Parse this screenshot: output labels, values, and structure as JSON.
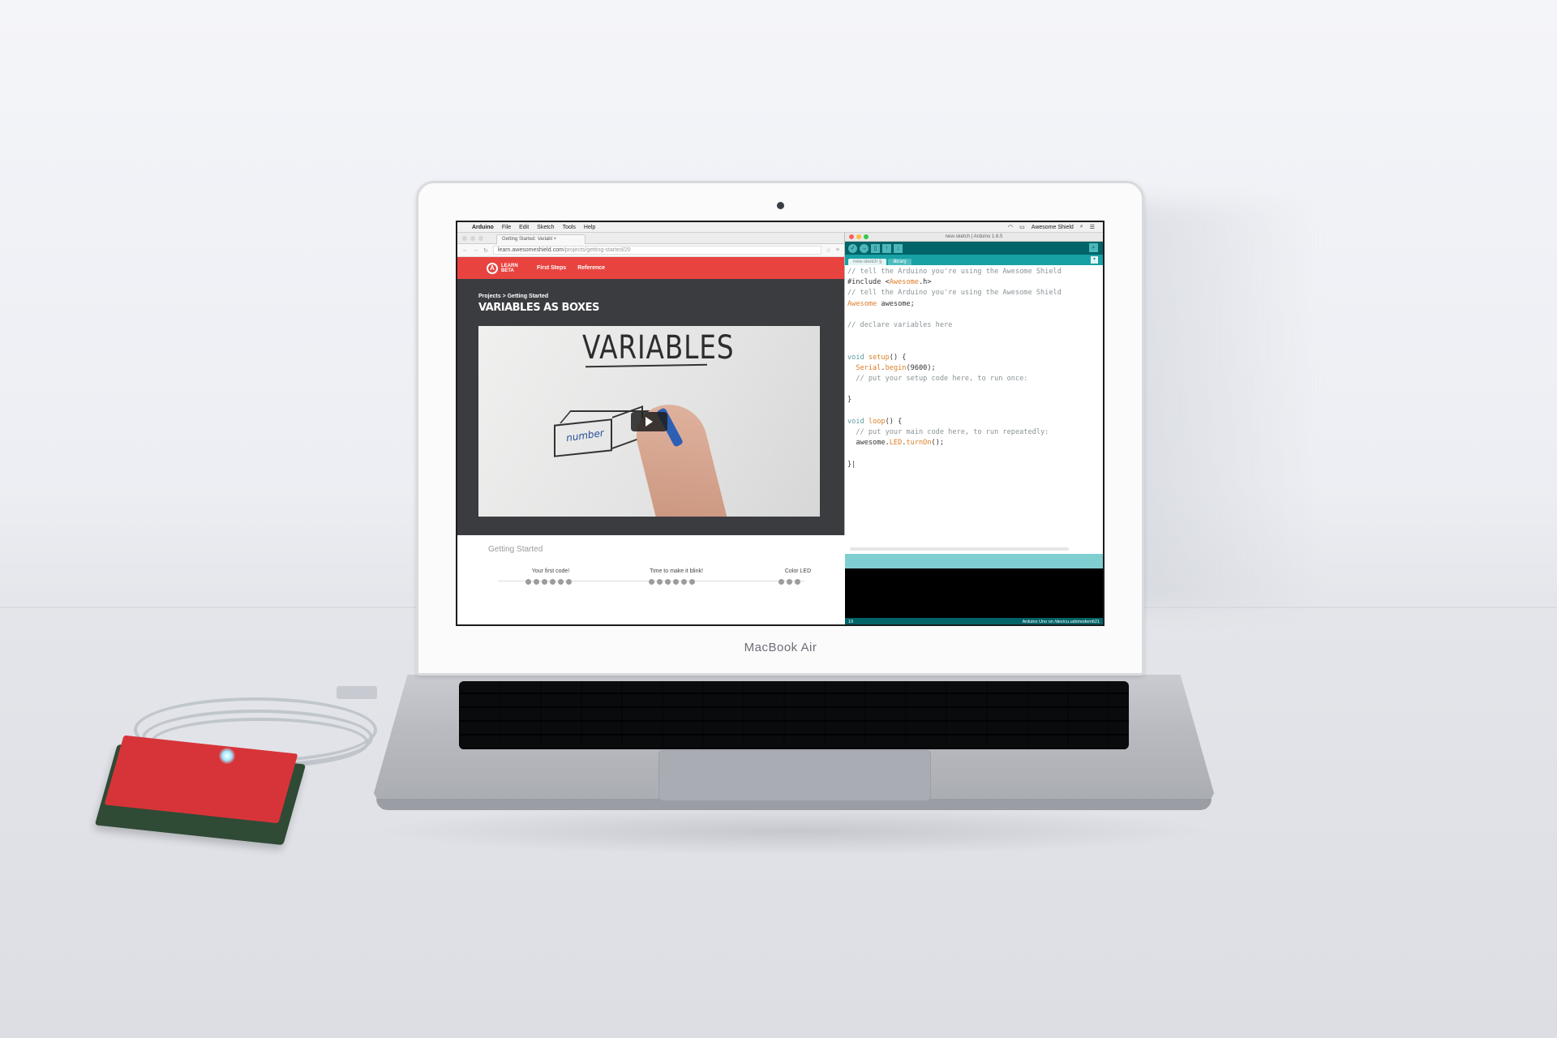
{
  "laptop": {
    "brand": "MacBook Air"
  },
  "menubar": {
    "app": "Arduino",
    "items": [
      "File",
      "Edit",
      "Sketch",
      "Tools",
      "Help"
    ],
    "wifi_icon": "wifi-icon",
    "user": "Awesome Shield"
  },
  "browser": {
    "tab_title": "Getting Started: Variabl",
    "url_host": "learn.awesomeshield.com",
    "url_path": "/projects/getting-started/20",
    "logo_mark": "A",
    "logo_text_1": "LEARN",
    "logo_text_2": "BETA",
    "nav": [
      "First Steps",
      "Reference"
    ],
    "breadcrumb": "Projects > Getting Started",
    "page_title": "VARIABLES AS BOXES",
    "video": {
      "board_title": "VARIABLES",
      "box_label": "number"
    },
    "section_title": "Getting Started",
    "lessons": [
      {
        "title": "Your first code!",
        "dots": 6
      },
      {
        "title": "Time to make it blink!",
        "dots": 6
      },
      {
        "title": "Color LED",
        "dots": 3
      }
    ]
  },
  "ide": {
    "window_title": "new-sketch | Arduino 1.6.5",
    "tabs": [
      "new-sketch §",
      "library"
    ],
    "status_line": "19",
    "status_board": "Arduino Uno on /dev/cu.usbmodem621",
    "code_lines": [
      [
        {
          "c": "cm",
          "t": "// tell the Arduino you're using the Awesome Shield"
        }
      ],
      [
        {
          "c": "",
          "t": "#include <"
        },
        {
          "c": "ty",
          "t": "Awesome"
        },
        {
          "c": "",
          "t": ".h>"
        }
      ],
      [
        {
          "c": "cm",
          "t": "// tell the Arduino you're using the Awesome Shield"
        }
      ],
      [
        {
          "c": "ty",
          "t": "Awesome"
        },
        {
          "c": "",
          "t": " awesome;"
        }
      ],
      [
        {
          "c": "",
          "t": ""
        }
      ],
      [
        {
          "c": "cm",
          "t": "// declare variables here"
        }
      ],
      [
        {
          "c": "",
          "t": ""
        }
      ],
      [
        {
          "c": "",
          "t": ""
        }
      ],
      [
        {
          "c": "kw",
          "t": "void"
        },
        {
          "c": "",
          "t": " "
        },
        {
          "c": "fn",
          "t": "setup"
        },
        {
          "c": "",
          "t": "() {"
        }
      ],
      [
        {
          "c": "",
          "t": "  "
        },
        {
          "c": "ty",
          "t": "Serial"
        },
        {
          "c": "",
          "t": "."
        },
        {
          "c": "fn",
          "t": "begin"
        },
        {
          "c": "",
          "t": "(9600);"
        }
      ],
      [
        {
          "c": "cm",
          "t": "  // put your setup code here, to run once:"
        }
      ],
      [
        {
          "c": "",
          "t": ""
        }
      ],
      [
        {
          "c": "",
          "t": "}"
        }
      ],
      [
        {
          "c": "",
          "t": ""
        }
      ],
      [
        {
          "c": "kw",
          "t": "void"
        },
        {
          "c": "",
          "t": " "
        },
        {
          "c": "fn",
          "t": "loop"
        },
        {
          "c": "",
          "t": "() {"
        }
      ],
      [
        {
          "c": "cm",
          "t": "  // put your main code here, to run repeatedly:"
        }
      ],
      [
        {
          "c": "",
          "t": "  awesome."
        },
        {
          "c": "ty",
          "t": "LED"
        },
        {
          "c": "",
          "t": "."
        },
        {
          "c": "fn",
          "t": "turnOn"
        },
        {
          "c": "",
          "t": "();"
        }
      ],
      [
        {
          "c": "",
          "t": ""
        }
      ],
      [
        {
          "c": "",
          "t": "}|"
        }
      ]
    ]
  },
  "colors": {
    "accent_red": "#e8433f",
    "arduino_teal": "#006468",
    "arduino_light": "#17a1a5"
  }
}
